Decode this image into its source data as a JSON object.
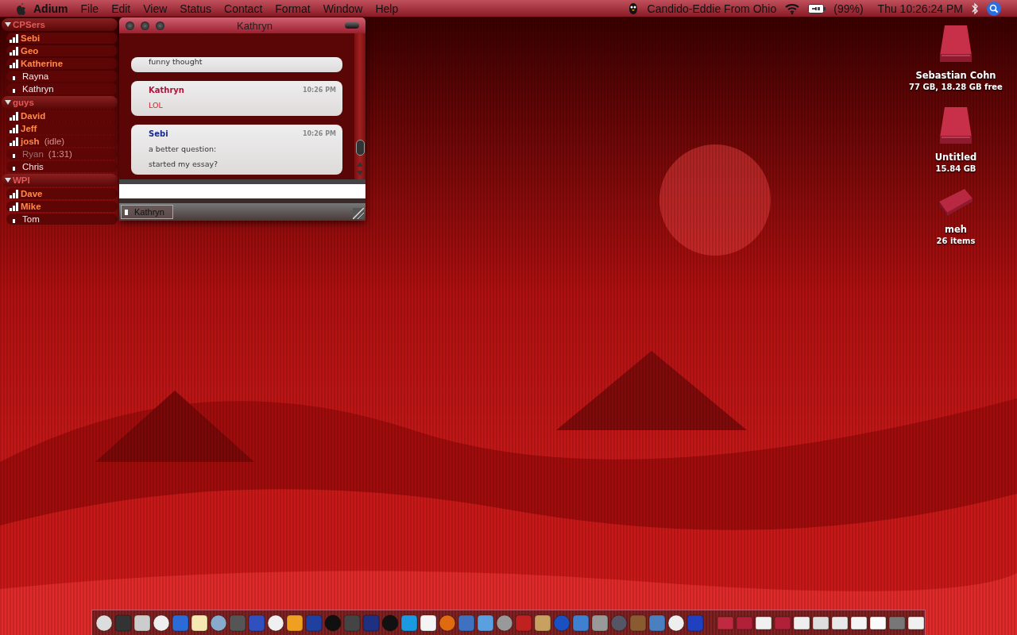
{
  "menu_bar": {
    "app": "Adium",
    "menus": [
      "File",
      "Edit",
      "View",
      "Status",
      "Contact",
      "Format",
      "Window",
      "Help"
    ],
    "account": "Candido-Eddie From Ohio",
    "battery": "(99%)",
    "clock": "Thu 10:26:24 PM"
  },
  "contact_list": {
    "groups": [
      {
        "name": "CPSers",
        "expanded": true,
        "contacts": [
          {
            "name": "Sebi",
            "kind": "online"
          },
          {
            "name": "Geo",
            "kind": "online"
          },
          {
            "name": "Katherine",
            "kind": "online"
          },
          {
            "name": "Rayna",
            "kind": "offline"
          },
          {
            "name": "Kathryn",
            "kind": "offline"
          }
        ]
      },
      {
        "name": "guys",
        "expanded": true,
        "contacts": [
          {
            "name": "David",
            "kind": "online"
          },
          {
            "name": "Jeff",
            "kind": "online"
          },
          {
            "name": "josh",
            "kind": "online",
            "note": "(idle)"
          },
          {
            "name": "Ryan",
            "kind": "idle",
            "note": "(1:31)"
          },
          {
            "name": "Chris",
            "kind": "offline"
          }
        ]
      },
      {
        "name": "WPI",
        "expanded": true,
        "contacts": [
          {
            "name": "Dave",
            "kind": "online"
          },
          {
            "name": "Mike",
            "kind": "online"
          },
          {
            "name": "Tom",
            "kind": "offline"
          }
        ]
      }
    ]
  },
  "chat_window": {
    "title": "Kathryn",
    "messages": [
      {
        "kind": "cut",
        "lines": [
          "funny thought"
        ]
      },
      {
        "kind": "incoming",
        "sender": "Kathryn",
        "color": "#b0123a",
        "time": "10:26 PM",
        "lines": [
          "LOL"
        ]
      },
      {
        "kind": "outgoing",
        "sender": "Sebi",
        "color": "#1a2a8c",
        "time": "10:26 PM",
        "lines": [
          "a better question:",
          "started my essay?"
        ]
      }
    ],
    "tabs": [
      {
        "label": "Kathryn",
        "selected": true
      }
    ]
  },
  "desktop_icons": [
    {
      "kind": "drive",
      "name": "Sebastian Cohn",
      "info": "77 GB, 18.28 GB free"
    },
    {
      "kind": "drive",
      "name": "Untitled",
      "info": "15.84 GB"
    },
    {
      "kind": "disk",
      "name": "meh",
      "info": "26 items"
    }
  ]
}
